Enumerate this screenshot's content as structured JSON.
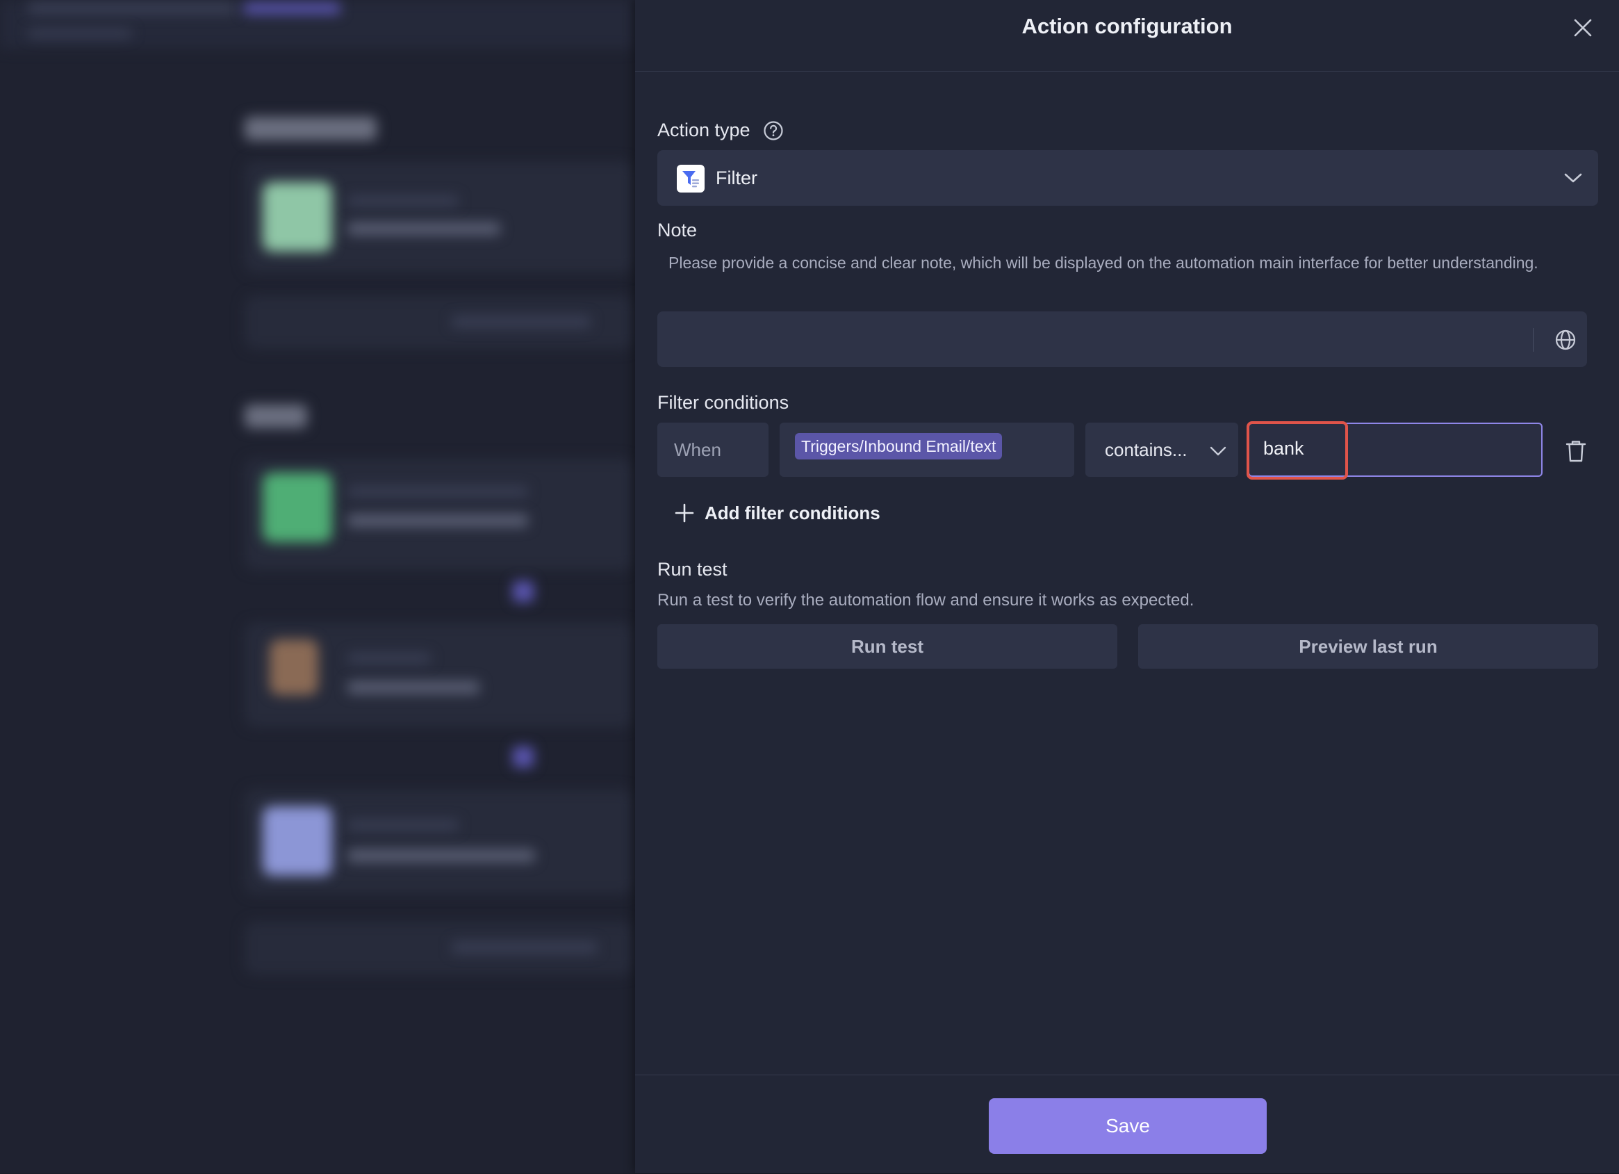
{
  "panel": {
    "title": "Action configuration"
  },
  "action_type": {
    "label": "Action type",
    "value": "Filter",
    "icon": "filter-icon"
  },
  "note": {
    "label": "Note",
    "description": "Please provide a concise and clear note, which will be displayed on the automation main interface for better understanding.",
    "value": "",
    "icon": "globe-icon"
  },
  "filter_conditions": {
    "label": "Filter conditions",
    "conditions": [
      {
        "when": "When",
        "field": "Triggers/Inbound Email/text",
        "operator": "contains...",
        "value": "bank"
      }
    ],
    "add_label": "Add filter conditions"
  },
  "run_test": {
    "label": "Run test",
    "description": "Run a test to verify the automation flow and ensure it works as expected.",
    "run_button": "Run test",
    "preview_button": "Preview last run"
  },
  "footer": {
    "save_label": "Save"
  },
  "colors": {
    "panel_bg": "#222636",
    "input_bg": "#2e3347",
    "accent": "#8b7fe8",
    "chip_bg": "#5b56a8",
    "highlight": "#e0544a"
  }
}
